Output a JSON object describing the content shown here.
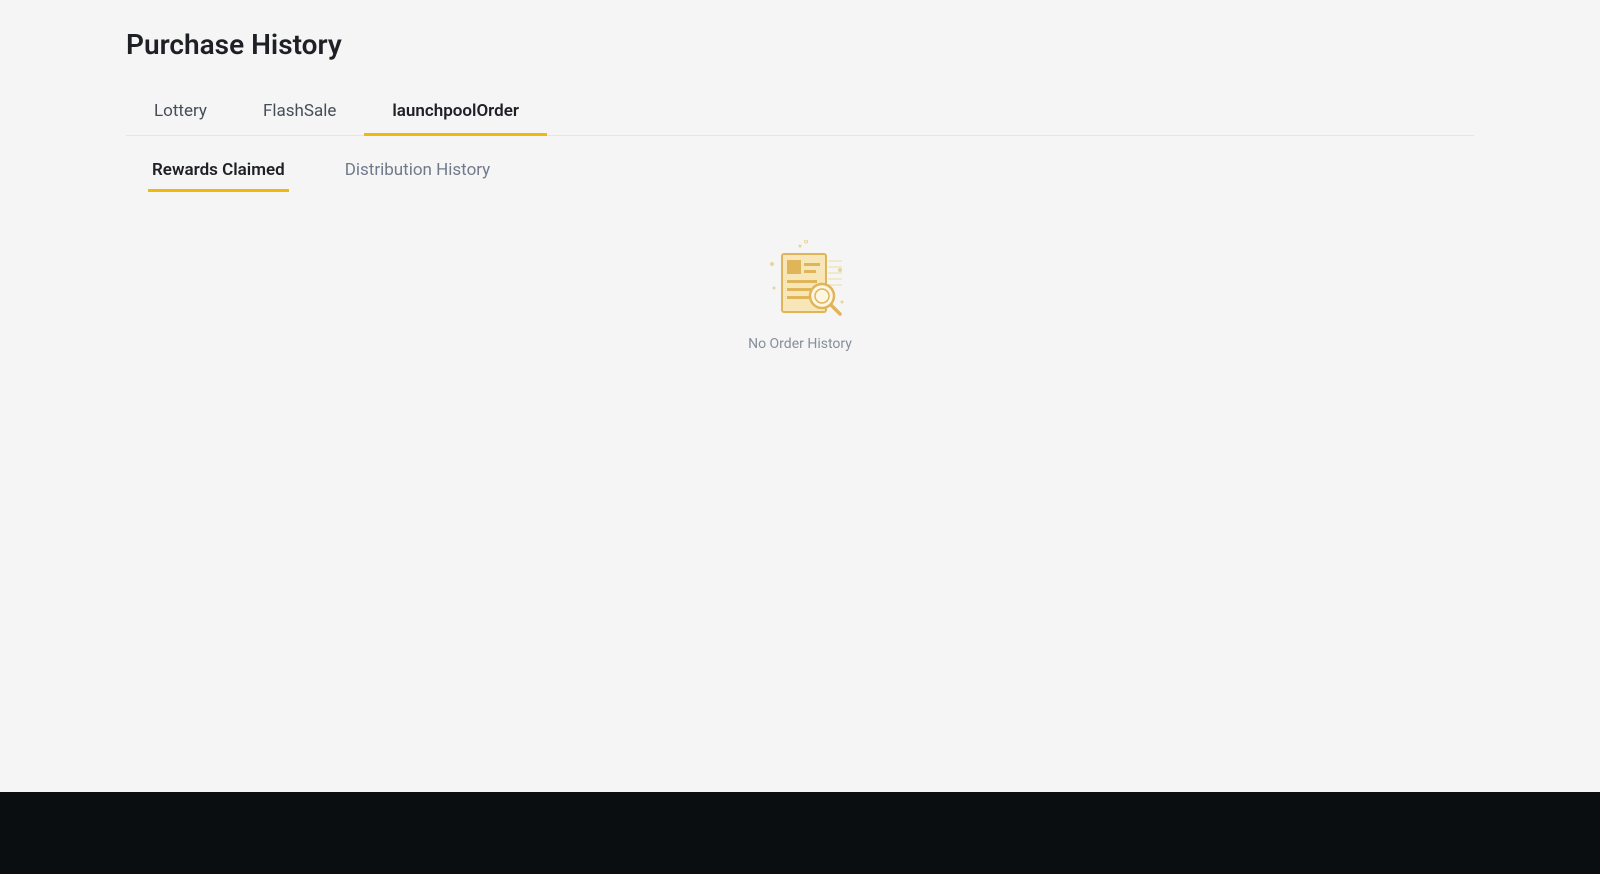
{
  "page": {
    "title": "Purchase History"
  },
  "primaryTabs": [
    {
      "label": "Lottery",
      "active": false
    },
    {
      "label": "FlashSale",
      "active": false
    },
    {
      "label": "launchpoolOrder",
      "active": true
    }
  ],
  "secondaryTabs": [
    {
      "label": "Rewards Claimed",
      "active": true
    },
    {
      "label": "Distribution History",
      "active": false
    }
  ],
  "emptyState": {
    "message": "No Order History"
  }
}
